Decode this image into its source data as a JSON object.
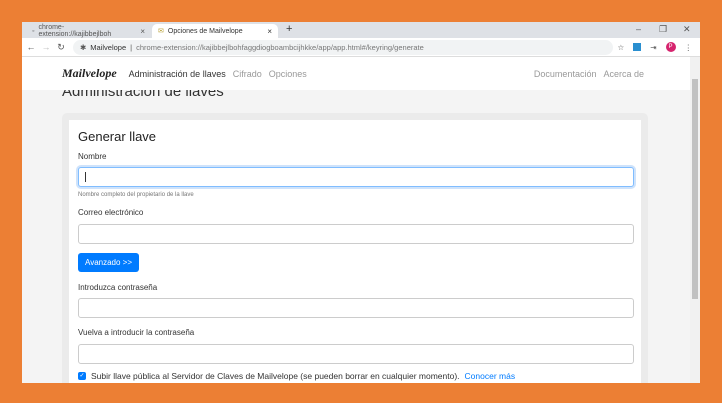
{
  "browser": {
    "tabs": [
      {
        "label": "chrome-extension://kajibbejlboh",
        "close": "×"
      },
      {
        "label": "Opciones de Mailvelope",
        "close": "×"
      }
    ],
    "new_tab": "+",
    "address_host": "Mailvelope",
    "address_path": "chrome-extension://kajibbejlbohfaggdiogboambcijhkke/app/app.html#/keyring/generate",
    "avatar": "P"
  },
  "navbar": {
    "brand": "Mailvelope",
    "items": [
      "Administración de llaves",
      "Cifrado",
      "Opciones"
    ],
    "right": [
      "Documentación",
      "Acerca de"
    ]
  },
  "page_title": "Administración de llaves",
  "form": {
    "title": "Generar llave",
    "name_label": "Nombre",
    "name_value": "",
    "name_help": "Nombre completo del propietario de la llave",
    "email_label": "Correo electrónico",
    "email_value": "",
    "advanced": "Avanzado >>",
    "pass_label": "Introduzca contraseña",
    "pass2_label": "Vuelva a introducir la contraseña",
    "upload_label": "Subir llave pública al Servidor de Claves de Mailvelope (se pueden borrar en cualquier momento).",
    "upload_checked": true,
    "learn_more": "Conocer más"
  }
}
